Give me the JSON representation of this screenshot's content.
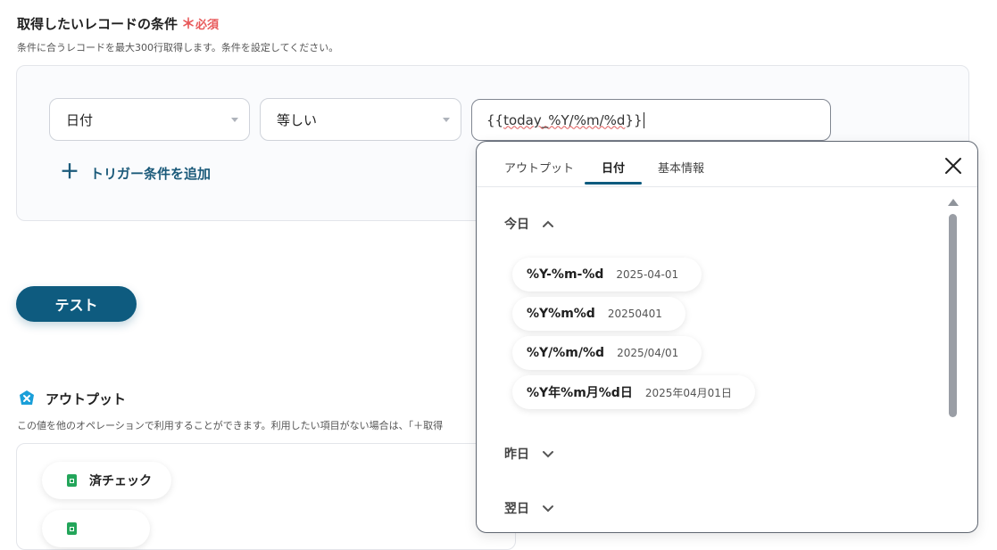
{
  "conditions": {
    "title": "取得したいレコードの条件",
    "required_mark": "＊",
    "required_label": "必須",
    "description": "条件に合うレコードを最大300行取得します。条件を設定してください。",
    "field_select": "日付",
    "operator_select": "等しい",
    "value_prefix": "{{",
    "value_main": "today_%Y/%m/%d",
    "value_suffix": "}}",
    "add_condition": "トリガー条件を追加"
  },
  "test_button": "テスト",
  "output": {
    "title": "アウトプット",
    "description": "この値を他のオペレーションで利用することができます。利用したい項目がない場合は、「＋取得",
    "items": [
      {
        "label": "済チェック"
      },
      {
        "label": ""
      }
    ]
  },
  "popup": {
    "tabs": [
      {
        "label": "アウトプット",
        "active": false
      },
      {
        "label": "日付",
        "active": true
      },
      {
        "label": "基本情報",
        "active": false
      }
    ],
    "close_icon": "close-icon",
    "sections": [
      {
        "label": "今日",
        "expanded": true,
        "formats": [
          {
            "format": "%Y-%m-%d",
            "example": "2025-04-01"
          },
          {
            "format": "%Y%m%d",
            "example": "20250401"
          },
          {
            "format": "%Y/%m/%d",
            "example": "2025/04/01"
          },
          {
            "format": "%Y年%m月%d日",
            "example": "2025年04月01日"
          }
        ]
      },
      {
        "label": "昨日",
        "expanded": false
      },
      {
        "label": "翌日",
        "expanded": false
      }
    ]
  },
  "colors": {
    "accent": "#0e5b7f",
    "required": "#e8595a",
    "sheet_green": "#23a55a"
  }
}
